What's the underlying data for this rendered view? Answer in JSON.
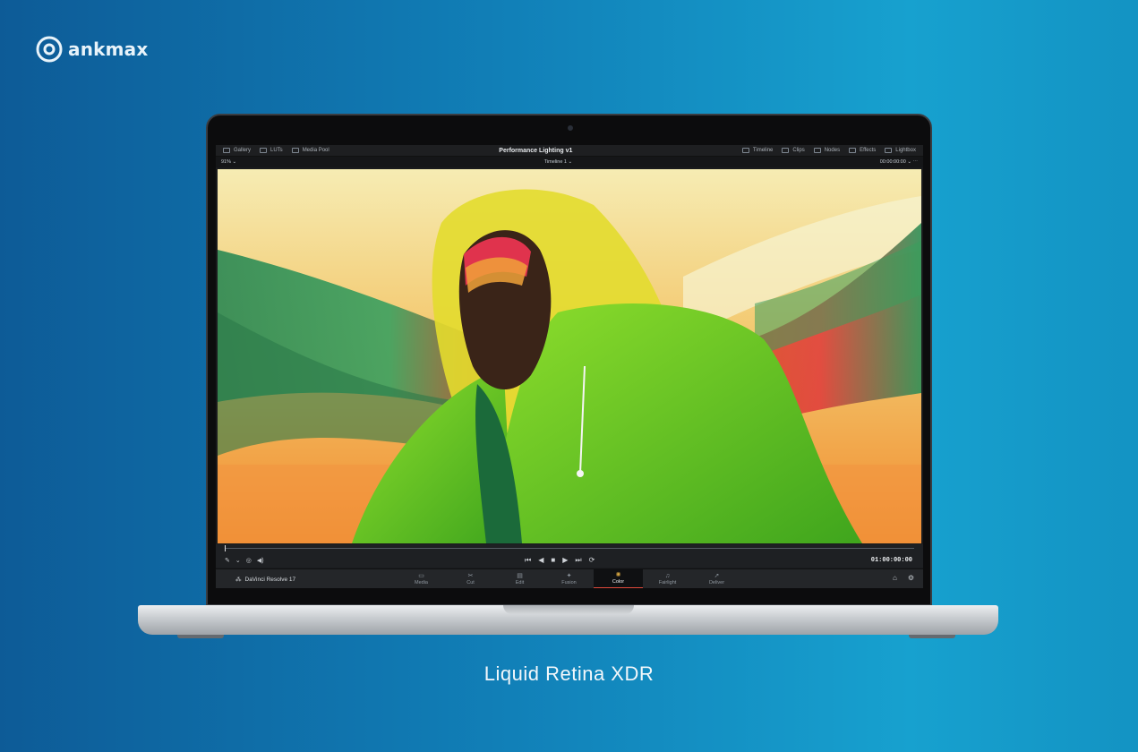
{
  "brand": {
    "name": "ankmax"
  },
  "caption": "Liquid Retina XDR",
  "resolve": {
    "topbar": {
      "left": [
        {
          "label": "Gallery",
          "icon": "gallery-icon"
        },
        {
          "label": "LUTs",
          "icon": "luts-icon"
        },
        {
          "label": "Media Pool",
          "icon": "media-pool-icon"
        }
      ],
      "title": "Performance Lighting v1",
      "right": [
        {
          "label": "Timeline",
          "icon": "timeline-icon"
        },
        {
          "label": "Clips",
          "icon": "clips-icon"
        },
        {
          "label": "Nodes",
          "icon": "nodes-icon"
        },
        {
          "label": "Effects",
          "icon": "effects-icon"
        },
        {
          "label": "Lightbox",
          "icon": "lightbox-icon"
        }
      ]
    },
    "subbar": {
      "zoom": "91%",
      "timeline": "Timeline 1",
      "timecode": "00:00:00:00"
    },
    "transport": {
      "timecode": "01:00:00:00",
      "buttons": [
        "⏮",
        "◀",
        "■",
        "▶",
        "⏭",
        "⟳"
      ]
    },
    "pagebar": {
      "app": "DaVinci Resolve 17",
      "tabs": [
        {
          "label": "Media",
          "icon": "▭"
        },
        {
          "label": "Cut",
          "icon": "✂"
        },
        {
          "label": "Edit",
          "icon": "▤"
        },
        {
          "label": "Fusion",
          "icon": "✦"
        },
        {
          "label": "Color",
          "icon": "✺"
        },
        {
          "label": "Fairlight",
          "icon": "♫"
        },
        {
          "label": "Deliver",
          "icon": "➚"
        }
      ],
      "active_tab": "Color"
    }
  }
}
